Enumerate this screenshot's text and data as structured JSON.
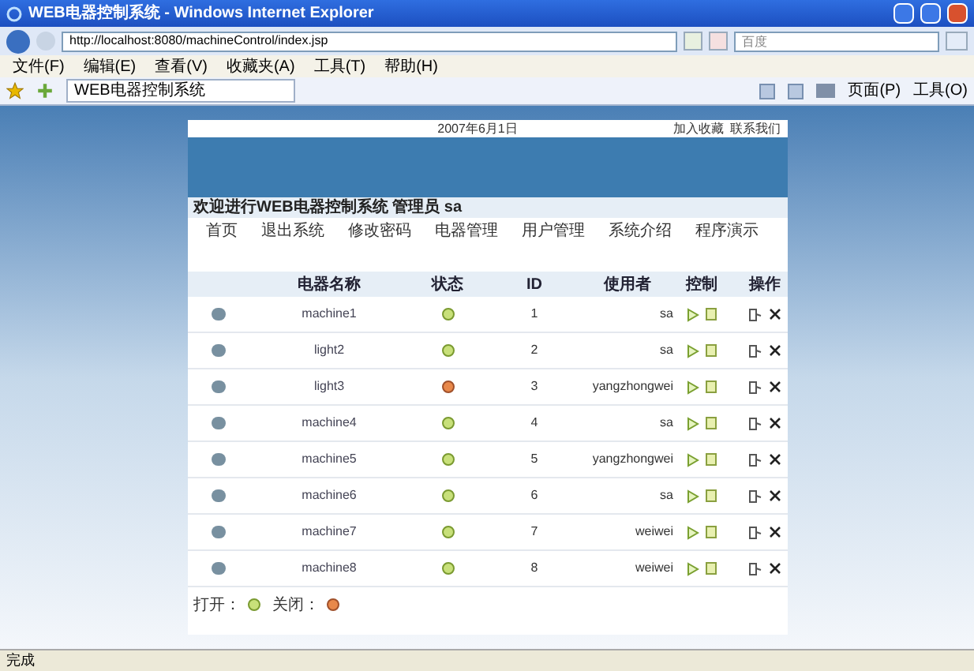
{
  "window": {
    "title": "WEB电器控制系统 - Windows Internet Explorer"
  },
  "address_bar": {
    "url": "http://localhost:8080/machineControl/index.jsp"
  },
  "search": {
    "placeholder": "百度"
  },
  "menu": [
    "文件(F)",
    "编辑(E)",
    "查看(V)",
    "收藏夹(A)",
    "工具(T)",
    "帮助(H)"
  ],
  "tab": {
    "label": "WEB电器控制系统"
  },
  "toolbar": [
    {
      "kind": "icon"
    },
    {
      "kind": "icon"
    },
    {
      "kind": "print"
    },
    {
      "kind": "text",
      "label": "页面(P)"
    },
    {
      "kind": "text",
      "label": "工具(O)"
    }
  ],
  "page": {
    "date": "2007年6月1日",
    "links": [
      "加入收藏",
      "联系我们"
    ],
    "welcome": "欢迎进行WEB电器控制系统 管理员 sa",
    "nav": [
      "首页",
      "退出系统",
      "修改密码",
      "电器管理",
      "用户管理",
      "系统介绍",
      "程序演示"
    ],
    "table": {
      "columns": [
        "电器名称",
        "状态",
        "ID",
        "使用者",
        "控制",
        "操作"
      ],
      "rows": [
        {
          "name": "machine1",
          "on": true,
          "id": "1",
          "user": "sa"
        },
        {
          "name": "light2",
          "on": true,
          "id": "2",
          "user": "sa"
        },
        {
          "name": "light3",
          "on": false,
          "id": "3",
          "user": "yangzhongwei"
        },
        {
          "name": "machine4",
          "on": true,
          "id": "4",
          "user": "sa"
        },
        {
          "name": "machine5",
          "on": true,
          "id": "5",
          "user": "yangzhongwei"
        },
        {
          "name": "machine6",
          "on": true,
          "id": "6",
          "user": "sa"
        },
        {
          "name": "machine7",
          "on": true,
          "id": "7",
          "user": "weiwei"
        },
        {
          "name": "machine8",
          "on": true,
          "id": "8",
          "user": "weiwei"
        }
      ]
    },
    "legend": [
      {
        "label": "打开：",
        "on": true
      },
      {
        "label": "关闭：",
        "on": false
      }
    ]
  },
  "status_bar": {
    "text": "完成"
  }
}
